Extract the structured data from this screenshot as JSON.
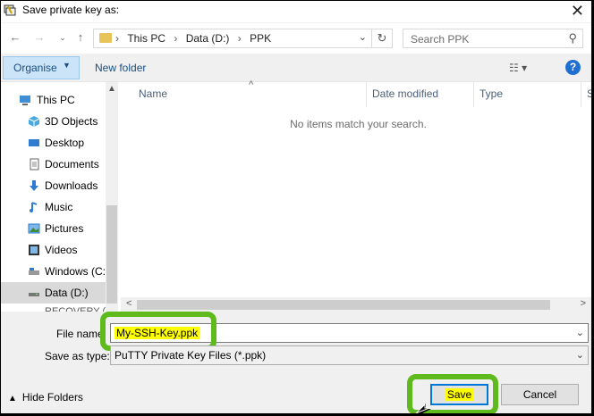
{
  "window": {
    "title": "Save private key as:"
  },
  "nav": {
    "breadcrumbs": [
      "This PC",
      "Data (D:)",
      "PPK"
    ],
    "search_placeholder": "Search PPK"
  },
  "toolbar": {
    "organise_label": "Organise",
    "new_folder_label": "New folder"
  },
  "sidebar": {
    "items": [
      {
        "label": "This PC",
        "icon": "computer-icon"
      },
      {
        "label": "3D Objects",
        "icon": "cube-icon"
      },
      {
        "label": "Desktop",
        "icon": "desktop-icon"
      },
      {
        "label": "Documents",
        "icon": "documents-icon"
      },
      {
        "label": "Downloads",
        "icon": "download-icon"
      },
      {
        "label": "Music",
        "icon": "music-icon"
      },
      {
        "label": "Pictures",
        "icon": "pictures-icon"
      },
      {
        "label": "Videos",
        "icon": "videos-icon"
      },
      {
        "label": "Windows (C:",
        "icon": "drive-icon"
      },
      {
        "label": "Data (D:)",
        "icon": "drive-icon"
      },
      {
        "label": "RECOVERY (F",
        "icon": "drive-icon"
      }
    ]
  },
  "filelist": {
    "columns": [
      "Name",
      "Date modified",
      "Type",
      "S"
    ],
    "empty_message": "No items match your search."
  },
  "form": {
    "filename_label": "File name",
    "filename_value": "My-SSH-Key.ppk",
    "savetype_label": "Save as type:",
    "savetype_value": "PuTTY Private Key Files (*.ppk)"
  },
  "footer": {
    "hide_folders_label": "Hide Folders",
    "save_label": "Save",
    "cancel_label": "Cancel"
  },
  "colors": {
    "highlight_ring": "#5fbb1d",
    "text_highlight": "#ffff00",
    "accent": "#0078d7"
  }
}
